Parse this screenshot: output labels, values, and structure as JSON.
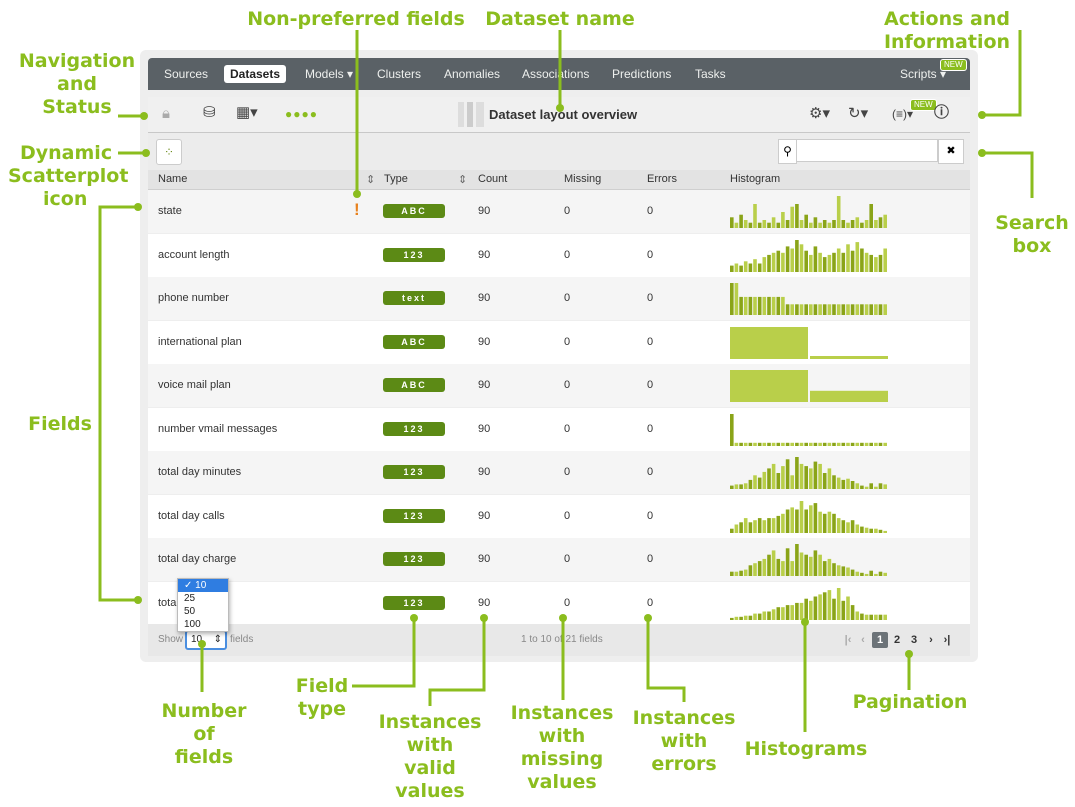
{
  "annotations": {
    "navigation": [
      "Navigation",
      "and",
      "Status"
    ],
    "dynamic_scatterplot": [
      "Dynamic",
      "Scatterplot",
      "icon"
    ],
    "fields": "Fields",
    "non_preferred": "Non-preferred fields",
    "dataset_name": "Dataset name",
    "actions": "Actions and Information",
    "search_box": [
      "Search",
      "box"
    ],
    "number_of_fields": [
      "Number",
      "of",
      "fields"
    ],
    "field_type": [
      "Field",
      "type"
    ],
    "valid_values": [
      "Instances",
      "with",
      "valid",
      "values"
    ],
    "missing_values": [
      "Instances",
      "with",
      "missing",
      "values"
    ],
    "errors": [
      "Instances",
      "with",
      "errors"
    ],
    "histograms": "Histograms",
    "pagination": "Pagination"
  },
  "nav": {
    "tabs": [
      "Sources",
      "Datasets",
      "Models ▾",
      "Clusters",
      "Anomalies",
      "Associations",
      "Predictions",
      "Tasks"
    ],
    "active": "Datasets",
    "scripts": "Scripts ▾",
    "new_badge": "NEW"
  },
  "toolbar": {
    "title": "Dataset layout overview",
    "icons": [
      "lock-icon",
      "database-search-icon",
      "field-types-icon",
      "status-dots-icon",
      "settings-icon",
      "sync-icon",
      "formula-icon",
      "info-icon"
    ],
    "new_badge": "NEW"
  },
  "search": {
    "placeholder": "",
    "clear": "✖",
    "icon": "search-icon"
  },
  "columns": [
    "Name",
    "Type",
    "Count",
    "Missing",
    "Errors",
    "Histogram"
  ],
  "rows": [
    {
      "name": "state",
      "type": "ABC",
      "count": "90",
      "missing": "0",
      "errors": "0",
      "warn": "!",
      "hist": [
        4,
        2,
        5,
        3,
        2,
        9,
        2,
        3,
        2,
        4,
        2,
        6,
        3,
        8,
        9,
        3,
        5,
        2,
        4,
        2,
        3,
        2,
        3,
        12,
        3,
        2,
        3,
        4,
        2,
        3,
        9,
        3,
        4,
        5
      ]
    },
    {
      "name": "account length",
      "type": "123",
      "count": "90",
      "missing": "0",
      "errors": "0",
      "hist": [
        3,
        4,
        3,
        5,
        4,
        6,
        4,
        7,
        8,
        9,
        10,
        9,
        12,
        11,
        15,
        13,
        10,
        8,
        12,
        9,
        7,
        8,
        9,
        11,
        9,
        13,
        10,
        14,
        11,
        9,
        8,
        7,
        8,
        11
      ]
    },
    {
      "name": "phone number",
      "type": "text",
      "count": "90",
      "missing": "0",
      "errors": "0",
      "hist": [
        30,
        30,
        17,
        17,
        17,
        17,
        17,
        17,
        17,
        17,
        17,
        17,
        10,
        10,
        10,
        10,
        10,
        10,
        10,
        10,
        10,
        10,
        10,
        10,
        10,
        10,
        10,
        10,
        10,
        10,
        10,
        10,
        10,
        10
      ]
    },
    {
      "name": "international plan",
      "type": "ABC",
      "count": "90",
      "missing": "0",
      "errors": "0",
      "hist2": [
        0.93,
        0.07
      ]
    },
    {
      "name": "voice mail plan",
      "type": "ABC",
      "count": "90",
      "missing": "0",
      "errors": "0",
      "hist2": [
        0.74,
        0.26
      ]
    },
    {
      "name": "number vmail messages",
      "type": "123",
      "count": "90",
      "missing": "0",
      "errors": "0",
      "hist": [
        30,
        3,
        3,
        3,
        3,
        3,
        3,
        3,
        3,
        3,
        3,
        3,
        3,
        3,
        3,
        3,
        3,
        3,
        3,
        3,
        3,
        3,
        3,
        3,
        3,
        3,
        3,
        3,
        3,
        3,
        3,
        3,
        3,
        3
      ]
    },
    {
      "name": "total day minutes",
      "type": "123",
      "count": "90",
      "missing": "0",
      "errors": "0",
      "hist": [
        3,
        4,
        4,
        5,
        8,
        12,
        10,
        15,
        18,
        22,
        14,
        20,
        26,
        12,
        28,
        22,
        20,
        18,
        24,
        22,
        14,
        18,
        12,
        10,
        8,
        9,
        7,
        5,
        3,
        2,
        5,
        2,
        5,
        4
      ]
    },
    {
      "name": "total day calls",
      "type": "123",
      "count": "90",
      "missing": "0",
      "errors": "0",
      "hist": [
        4,
        8,
        10,
        14,
        10,
        12,
        14,
        12,
        14,
        14,
        16,
        18,
        22,
        24,
        22,
        30,
        22,
        26,
        28,
        20,
        18,
        20,
        18,
        14,
        12,
        10,
        12,
        8,
        6,
        5,
        4,
        4,
        3,
        2
      ]
    },
    {
      "name": "total day charge",
      "type": "123",
      "count": "90",
      "missing": "0",
      "errors": "0",
      "hist": [
        4,
        4,
        5,
        6,
        10,
        12,
        14,
        16,
        20,
        24,
        16,
        14,
        26,
        14,
        30,
        22,
        20,
        18,
        24,
        20,
        14,
        16,
        12,
        10,
        9,
        8,
        6,
        4,
        3,
        2,
        5,
        2,
        4,
        3
      ]
    },
    {
      "name": "total",
      "type": "123",
      "count": "90",
      "missing": "0",
      "errors": "0",
      "hist": [
        2,
        3,
        3,
        4,
        4,
        6,
        6,
        8,
        8,
        10,
        12,
        12,
        14,
        14,
        16,
        16,
        20,
        18,
        22,
        24,
        26,
        28,
        20,
        30,
        18,
        22,
        14,
        8,
        6,
        5,
        5,
        5,
        5,
        5
      ]
    }
  ],
  "footer": {
    "show": "Show",
    "per_page": "10",
    "fields": "fields",
    "summary": "1 to 10 of 21 fields",
    "pages": [
      "1",
      "2",
      "3"
    ],
    "current_page": "1"
  },
  "dropdown_options": [
    "10",
    "25",
    "50",
    "100"
  ],
  "dropdown_selected": "10",
  "colors": {
    "accent": "#8bbd1e",
    "badge": "#5c8a15",
    "bar_dark": "#8aa418",
    "bar_light": "#b9cf4a",
    "warn": "#e8821e",
    "nav": "#5a6166"
  }
}
